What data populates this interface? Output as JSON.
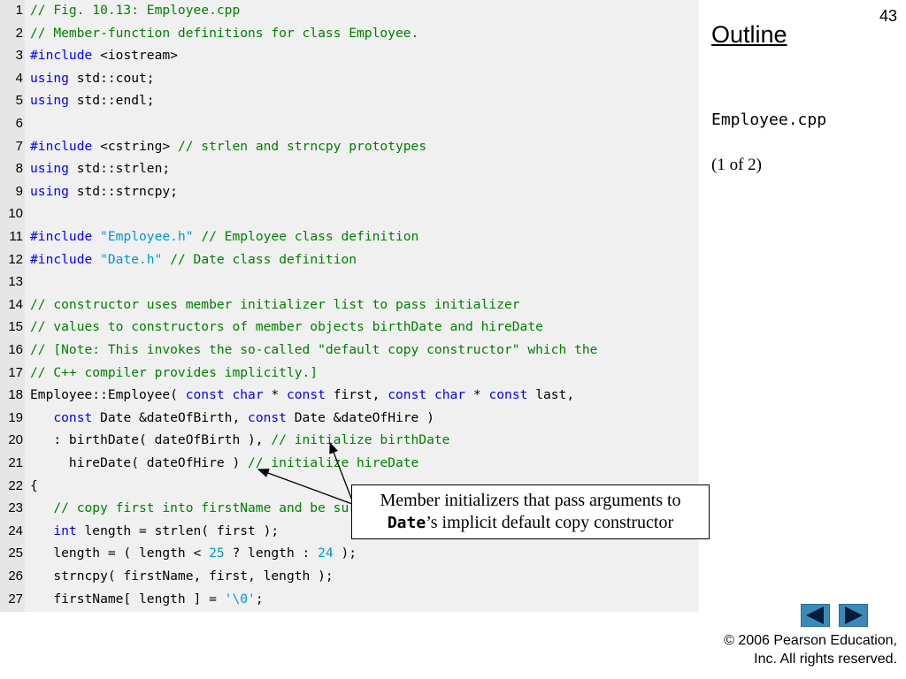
{
  "slide_number": "43",
  "outline_title": "Outline",
  "file_name": "Employee.cpp",
  "part_label": "(1 of 2)",
  "callout": {
    "line1": "Member initializers that pass arguments to",
    "code": "Date",
    "rest": "’s implicit default copy constructor"
  },
  "copyright": {
    "line1": "© 2006 Pearson Education,",
    "line2": "Inc.  All rights reserved."
  },
  "nav": {
    "prev_icon": "triangle-left",
    "next_icon": "triangle-right"
  },
  "colors": {
    "comment": "#008000",
    "keyword": "#0000ff",
    "string": "#0099cc",
    "panel": "#f0f0f0",
    "nav_button": "#3a8ab8"
  },
  "code_lines": [
    {
      "n": "1",
      "segs": [
        [
          "c",
          "// Fig. 10.13: Employee.cpp"
        ]
      ]
    },
    {
      "n": "2",
      "segs": [
        [
          "c",
          "// Member-function definitions for class Employee."
        ]
      ]
    },
    {
      "n": "3",
      "segs": [
        [
          "k",
          "#include"
        ],
        [
          "t",
          " <iostream>"
        ]
      ]
    },
    {
      "n": "4",
      "segs": [
        [
          "k",
          "using"
        ],
        [
          "t",
          " std::cout;"
        ]
      ]
    },
    {
      "n": "5",
      "segs": [
        [
          "k",
          "using"
        ],
        [
          "t",
          " std::endl;"
        ]
      ]
    },
    {
      "n": "6",
      "segs": []
    },
    {
      "n": "7",
      "segs": [
        [
          "k",
          "#include"
        ],
        [
          "t",
          " <cstring> "
        ],
        [
          "c",
          "// strlen and strncpy prototypes"
        ]
      ]
    },
    {
      "n": "8",
      "segs": [
        [
          "k",
          "using"
        ],
        [
          "t",
          " std::strlen;"
        ]
      ]
    },
    {
      "n": "9",
      "segs": [
        [
          "k",
          "using"
        ],
        [
          "t",
          " std::strncpy;"
        ]
      ]
    },
    {
      "n": "10",
      "segs": []
    },
    {
      "n": "11",
      "segs": [
        [
          "k",
          "#include"
        ],
        [
          "t",
          " "
        ],
        [
          "s",
          "\"Employee.h\""
        ],
        [
          "t",
          " "
        ],
        [
          "c",
          "// Employee class definition"
        ]
      ]
    },
    {
      "n": "12",
      "segs": [
        [
          "k",
          "#include"
        ],
        [
          "t",
          " "
        ],
        [
          "s",
          "\"Date.h\""
        ],
        [
          "t",
          " "
        ],
        [
          "c",
          "// Date class definition"
        ]
      ]
    },
    {
      "n": "13",
      "segs": []
    },
    {
      "n": "14",
      "segs": [
        [
          "c",
          "// constructor uses member initializer list to pass initializer"
        ]
      ]
    },
    {
      "n": "15",
      "segs": [
        [
          "c",
          "// values to constructors of member objects birthDate and hireDate"
        ]
      ]
    },
    {
      "n": "16",
      "segs": [
        [
          "c",
          "// [Note: This invokes the so-called \"default copy constructor\" which the"
        ]
      ]
    },
    {
      "n": "17",
      "segs": [
        [
          "c",
          "// C++ compiler provides implicitly.]"
        ]
      ]
    },
    {
      "n": "18",
      "segs": [
        [
          "t",
          "Employee::Employee( "
        ],
        [
          "k",
          "const"
        ],
        [
          "t",
          " "
        ],
        [
          "k",
          "char"
        ],
        [
          "t",
          " * "
        ],
        [
          "k",
          "const"
        ],
        [
          "t",
          " first, "
        ],
        [
          "k",
          "const"
        ],
        [
          "t",
          " "
        ],
        [
          "k",
          "char"
        ],
        [
          "t",
          " * "
        ],
        [
          "k",
          "const"
        ],
        [
          "t",
          " last,"
        ]
      ]
    },
    {
      "n": "19",
      "segs": [
        [
          "t",
          "   "
        ],
        [
          "k",
          "const"
        ],
        [
          "t",
          " Date &dateOfBirth, "
        ],
        [
          "k",
          "const"
        ],
        [
          "t",
          " Date &dateOfHire )"
        ]
      ]
    },
    {
      "n": "20",
      "segs": [
        [
          "t",
          "   : birthDate( dateOfBirth ), "
        ],
        [
          "c",
          "// initialize birthDate"
        ]
      ]
    },
    {
      "n": "21",
      "segs": [
        [
          "t",
          "     hireDate( dateOfHire ) "
        ],
        [
          "c",
          "// initialize hireDate"
        ]
      ]
    },
    {
      "n": "22",
      "segs": [
        [
          "t",
          "{"
        ]
      ]
    },
    {
      "n": "23",
      "segs": [
        [
          "t",
          "   "
        ],
        [
          "c",
          "// copy first into firstName and be sure that it fits"
        ]
      ]
    },
    {
      "n": "24",
      "segs": [
        [
          "t",
          "   "
        ],
        [
          "k",
          "int"
        ],
        [
          "t",
          " length = strlen( first );"
        ]
      ]
    },
    {
      "n": "25",
      "segs": [
        [
          "t",
          "   length = ( length < "
        ],
        [
          "s",
          "25"
        ],
        [
          "t",
          " ? length : "
        ],
        [
          "s",
          "24"
        ],
        [
          "t",
          " );"
        ]
      ]
    },
    {
      "n": "26",
      "segs": [
        [
          "t",
          "   strncpy( firstName, first, length );"
        ]
      ]
    },
    {
      "n": "27",
      "segs": [
        [
          "t",
          "   firstName[ length ] = "
        ],
        [
          "s",
          "'\\0'"
        ],
        [
          "t",
          ";"
        ]
      ]
    }
  ]
}
